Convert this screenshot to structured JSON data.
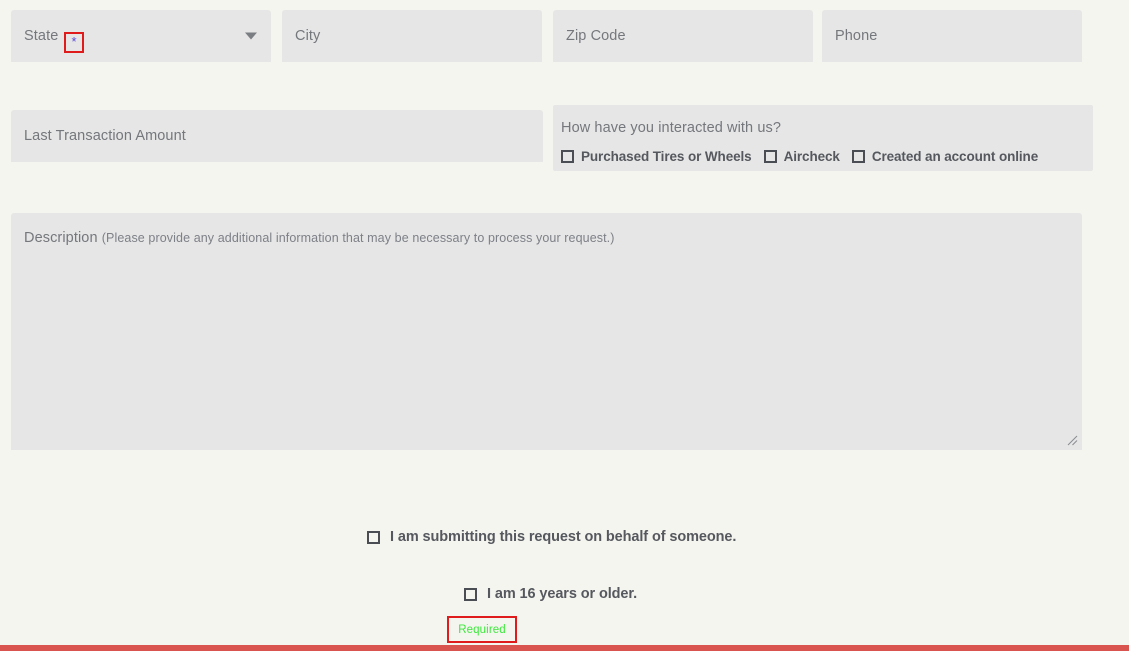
{
  "colors": {
    "page_background": "#f5f5ef",
    "field_background": "#e6e6e6",
    "placeholder_text": "#74777c",
    "label_text": "#55585e",
    "annotation_border": "#e01b1b",
    "required_text": "#3ee83e",
    "required_asterisk": "#5a49d6",
    "bottom_bar": "#d9534f"
  },
  "form": {
    "row1": {
      "state": {
        "placeholder": "State",
        "required_marker": "*",
        "dropdown_icon": "chevron-down-icon"
      },
      "city": {
        "placeholder": "City"
      },
      "zip": {
        "placeholder": "Zip Code"
      },
      "phone": {
        "placeholder": "Phone"
      }
    },
    "row2": {
      "amount": {
        "placeholder": "Last Transaction Amount"
      },
      "interaction": {
        "question": "How have you interacted with us?",
        "options": [
          {
            "label": "Purchased Tires or Wheels",
            "checked": false
          },
          {
            "label": "Aircheck",
            "checked": false
          },
          {
            "label": "Created an account online",
            "checked": false
          }
        ]
      }
    },
    "description": {
      "label": "Description",
      "hint": "(Please provide any additional information that may be necessary to process your request.)",
      "value": "",
      "resize_handle": "resize-grip-icon"
    },
    "consents": [
      {
        "label": "I am submitting this request on behalf of someone.",
        "checked": false
      },
      {
        "label": "I am 16 years or older.",
        "checked": false
      }
    ],
    "validation": {
      "required_message": "Required"
    }
  }
}
